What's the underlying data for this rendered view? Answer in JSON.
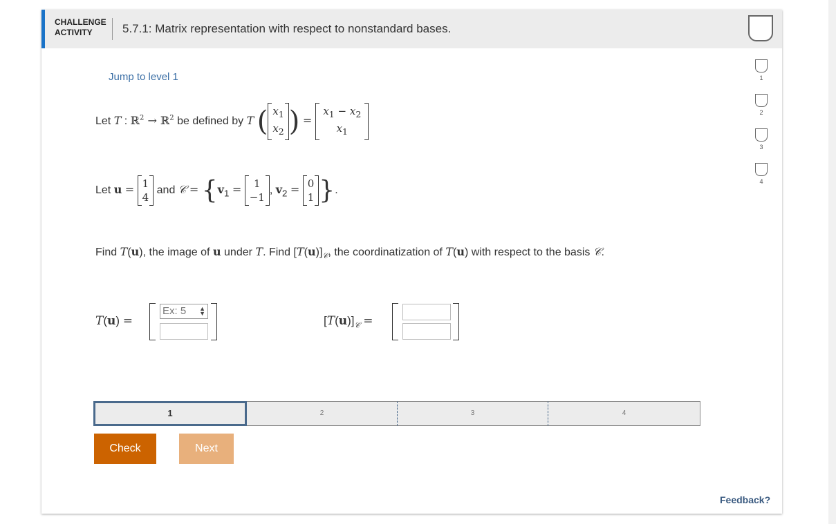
{
  "header": {
    "label_line1": "CHALLENGE",
    "label_line2": "ACTIVITY",
    "title": "5.7.1: Matrix representation with respect to nonstandard bases."
  },
  "levels": [
    "1",
    "2",
    "3",
    "4"
  ],
  "jump_link": "Jump to level 1",
  "problem": {
    "let1_prefix": "Let ",
    "defined_by": " be defined by ",
    "let2_prefix": "Let ",
    "and_text": " and ",
    "find_1": "Find ",
    "find_2": ", the image of ",
    "find_3": " under ",
    "find_4": ". Find ",
    "find_5": ", the coordinatization of ",
    "find_6": " with respect to the basis ",
    "find_7": "."
  },
  "answer": {
    "spin_placeholder": "Ex: 5"
  },
  "progress": {
    "segments": [
      "1",
      "2",
      "3",
      "4"
    ],
    "active_index": 0
  },
  "buttons": {
    "check": "Check",
    "next": "Next"
  },
  "feedback": "Feedback?",
  "colors": {
    "accent": "#1a73c8",
    "check": "#cc6300",
    "next": "#e8b07c",
    "link": "#3a6ea5"
  }
}
